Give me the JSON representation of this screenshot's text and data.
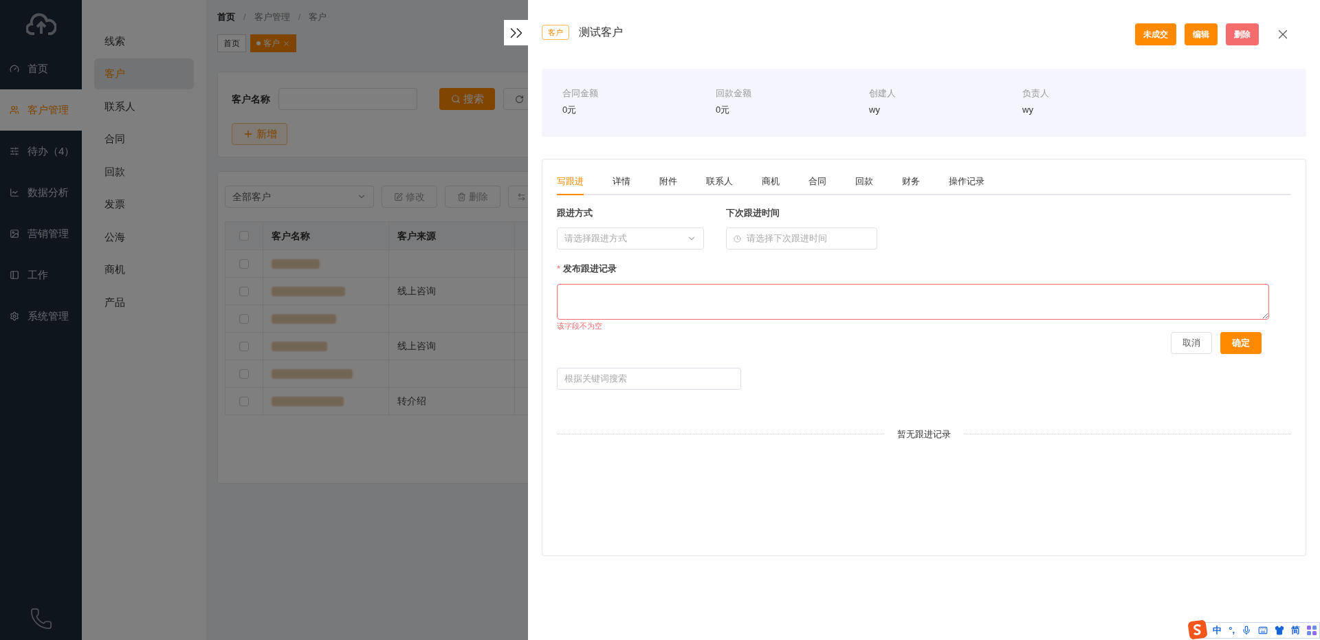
{
  "sidebar": {
    "items": [
      {
        "label": "首页",
        "selected": false
      },
      {
        "label": "客户管理",
        "selected": true
      },
      {
        "label": "待办（4）",
        "selected": false
      },
      {
        "label": "数据分析",
        "selected": false
      },
      {
        "label": "营销管理",
        "selected": false
      },
      {
        "label": "工作",
        "selected": false
      },
      {
        "label": "系统管理",
        "selected": false
      }
    ]
  },
  "subnav": {
    "items": [
      {
        "label": "线索",
        "selected": false
      },
      {
        "label": "客户",
        "selected": true
      },
      {
        "label": "联系人",
        "selected": false
      },
      {
        "label": "合同",
        "selected": false
      },
      {
        "label": "回款",
        "selected": false
      },
      {
        "label": "发票",
        "selected": false
      },
      {
        "label": "公海",
        "selected": false
      },
      {
        "label": "商机",
        "selected": false
      },
      {
        "label": "产品",
        "selected": false
      }
    ]
  },
  "breadcrumb": [
    "首页",
    "客户管理",
    "客户"
  ],
  "breadcrumb_separator": "/",
  "page_tabs": [
    {
      "label": "首页",
      "selected": false
    },
    {
      "label": "客户",
      "selected": true
    }
  ],
  "search": {
    "label": "客户名称",
    "button": "搜索",
    "add_button": "新增"
  },
  "list": {
    "header_checked": false,
    "filter": "全部客户",
    "actions": [
      "修改",
      "删除"
    ],
    "columns": [
      "客户名称",
      "客户来源"
    ],
    "rows": [
      {
        "checked": false
      },
      {
        "checked": false,
        "source": "线上咨询"
      },
      {
        "checked": false
      },
      {
        "checked": false,
        "source": "线上咨询"
      },
      {
        "checked": false
      },
      {
        "checked": false,
        "source": "转介绍"
      }
    ]
  },
  "drawer": {
    "tag": "客户",
    "title": "测试客户",
    "buttons": [
      {
        "label": "未成交",
        "kind": "primary"
      },
      {
        "label": "编辑",
        "kind": "primary"
      },
      {
        "label": "删除",
        "kind": "danger"
      }
    ],
    "stats": [
      {
        "label": "合同金额",
        "value": "0元"
      },
      {
        "label": "回款金额",
        "value": "0元"
      },
      {
        "label": "创建人",
        "value": "wy"
      },
      {
        "label": "负责人",
        "value": "wy"
      }
    ],
    "tabs": [
      {
        "label": "写跟进",
        "selected": true
      },
      {
        "label": "详情",
        "selected": false
      },
      {
        "label": "附件",
        "selected": false
      },
      {
        "label": "联系人",
        "selected": false
      },
      {
        "label": "商机",
        "selected": false
      },
      {
        "label": "合同",
        "selected": false
      },
      {
        "label": "回款",
        "selected": false
      },
      {
        "label": "财务",
        "selected": false
      },
      {
        "label": "操作记录",
        "selected": false
      }
    ],
    "form": {
      "method_label": "跟进方式",
      "method_placeholder": "请选择跟进方式",
      "time_label": "下次跟进时间",
      "time_placeholder": "请选择下次跟进时间",
      "record_label": "发布跟进记录",
      "required_mark": "*",
      "error": "该字段不为空",
      "cancel": "取消",
      "confirm": "确定"
    },
    "keyword_placeholder": "根据关键词搜索",
    "empty": "暂无跟进记录"
  },
  "ime": {
    "items": [
      "中",
      "°,",
      "简"
    ]
  }
}
